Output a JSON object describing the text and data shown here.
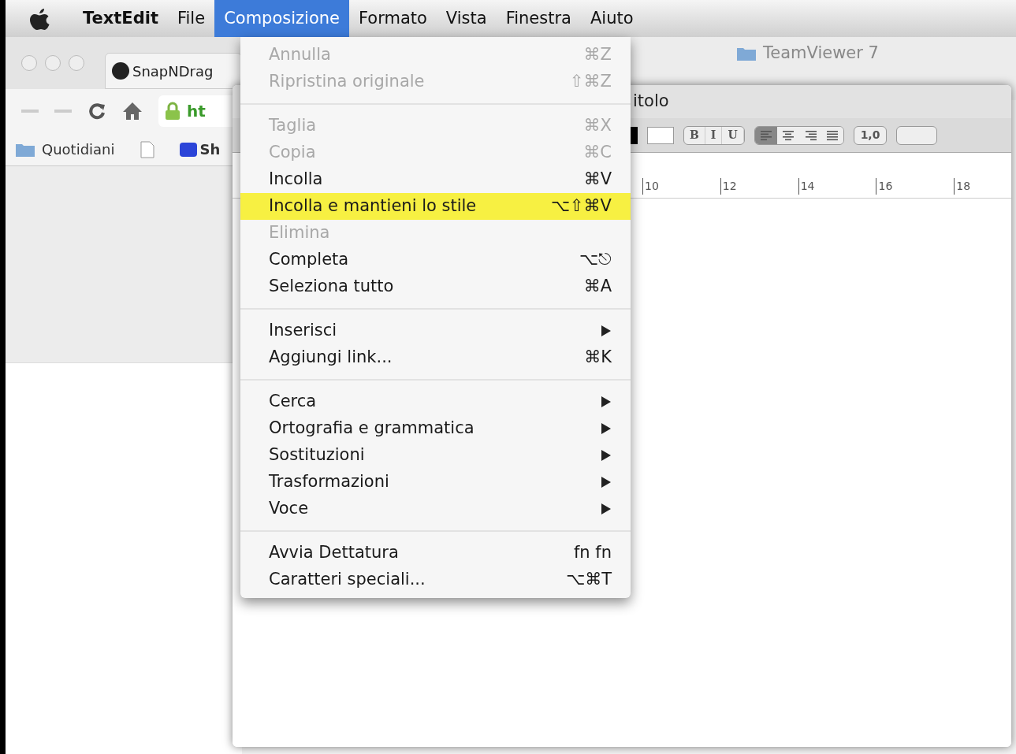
{
  "menubar": {
    "items": [
      {
        "label": "TextEdit",
        "selected": false,
        "app": true
      },
      {
        "label": "File",
        "selected": false,
        "app": false
      },
      {
        "label": "Composizione",
        "selected": true,
        "app": false
      },
      {
        "label": "Formato",
        "selected": false,
        "app": false
      },
      {
        "label": "Vista",
        "selected": false,
        "app": false
      },
      {
        "label": "Finestra",
        "selected": false,
        "app": false
      },
      {
        "label": "Aiuto",
        "selected": false,
        "app": false
      }
    ]
  },
  "browser": {
    "tab_title": "SnapNDrag",
    "url": "ht",
    "bookmarks": [
      {
        "kind": "folder",
        "label": "Quotidiani"
      },
      {
        "kind": "page"
      },
      {
        "kind": "site",
        "label": "Sh"
      }
    ]
  },
  "finder_window": {
    "title": "TeamViewer 7"
  },
  "textedit": {
    "title": "itolo",
    "style_buttons": [
      "B",
      "I",
      "U"
    ],
    "alignment": [
      {
        "kind": "left",
        "selected": true
      },
      {
        "kind": "center",
        "selected": false
      },
      {
        "kind": "right",
        "selected": false
      },
      {
        "kind": "justify",
        "selected": false
      }
    ],
    "spacing": "1,0",
    "ruler": [
      "10",
      "12",
      "14",
      "16",
      "18"
    ]
  },
  "menu": {
    "groups": [
      [
        {
          "label": "Annulla",
          "shortcut": "⌘Z",
          "disabled": true,
          "selected": false,
          "submenu": false
        },
        {
          "label": "Ripristina originale",
          "shortcut": "⇧⌘Z",
          "disabled": true,
          "selected": false,
          "submenu": false
        }
      ],
      [
        {
          "label": "Taglia",
          "shortcut": "⌘X",
          "disabled": true,
          "selected": false,
          "submenu": false
        },
        {
          "label": "Copia",
          "shortcut": "⌘C",
          "disabled": true,
          "selected": false,
          "submenu": false
        },
        {
          "label": "Incolla",
          "shortcut": "⌘V",
          "disabled": false,
          "selected": false,
          "submenu": false
        },
        {
          "label": "Incolla e mantieni lo stile",
          "shortcut": "⌥⇧⌘V",
          "disabled": false,
          "selected": true,
          "submenu": false
        },
        {
          "label": "Elimina",
          "disabled": true,
          "selected": false,
          "submenu": false
        },
        {
          "label": "Completa",
          "shortcut": "⌥⎋",
          "disabled": false,
          "selected": false,
          "submenu": false
        },
        {
          "label": "Seleziona tutto",
          "shortcut": "⌘A",
          "disabled": false,
          "selected": false,
          "submenu": false
        }
      ],
      [
        {
          "label": "Inserisci",
          "disabled": false,
          "selected": false,
          "submenu": true
        },
        {
          "label": "Aggiungi link...",
          "shortcut": "⌘K",
          "disabled": false,
          "selected": false,
          "submenu": false
        }
      ],
      [
        {
          "label": "Cerca",
          "disabled": false,
          "selected": false,
          "submenu": true
        },
        {
          "label": "Ortografia e grammatica",
          "disabled": false,
          "selected": false,
          "submenu": true
        },
        {
          "label": "Sostituzioni",
          "disabled": false,
          "selected": false,
          "submenu": true
        },
        {
          "label": "Trasformazioni",
          "disabled": false,
          "selected": false,
          "submenu": true
        },
        {
          "label": "Voce",
          "disabled": false,
          "selected": false,
          "submenu": true
        }
      ],
      [
        {
          "label": "Avvia Dettatura",
          "shortcut": "fn fn",
          "disabled": false,
          "selected": false,
          "submenu": false
        },
        {
          "label": "Caratteri speciali...",
          "shortcut": "⌥⌘T",
          "disabled": false,
          "selected": false,
          "submenu": false
        }
      ]
    ]
  }
}
